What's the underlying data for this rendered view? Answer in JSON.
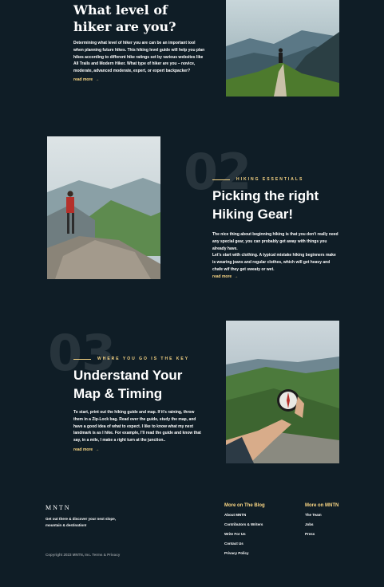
{
  "sections": [
    {
      "heading_lines": [
        "What level of",
        "hiker are you?"
      ],
      "body": "Determining what level of hiker you are can be an important tool when planning future hikes. This hiking level guide will help you plan hikes according to different hike ratings set by various websites like All Trails and Modern Hiker. What type of hiker are you – novice, moderate, advanced moderate, expert, or expert backpacker?",
      "read_more": "read more",
      "image_icon": "hiker-on-ridge-photo"
    },
    {
      "number": "02",
      "eyebrow": "HIKING ESSENTIALS",
      "heading_lines": [
        "Picking the right",
        "Hiking Gear!"
      ],
      "body": "The nice thing about beginning hiking is that you don't really need any special gear, you can probably get away with things you already have.\nLet's start with clothing. A typical mistake hiking beginners make is wearing jeans and regular clothes, which will get heavy and chafe wif they get sweaty or wet.",
      "read_more": "read more",
      "image_icon": "hiker-on-rock-photo"
    },
    {
      "number": "03",
      "eyebrow": "WHERE YOU GO IS THE KEY",
      "heading_lines": [
        "Understand Your",
        "Map & Timing"
      ],
      "body": "To start, print out the hiking guide and map. If it's raining, throw them in a Zip-Lock bag. Read over the guide, study the map, and have a good idea of what to expect. I like to know what my next landmark is as I hike. For example, I'll read the guide and know that say, in a mile, I make a right turn at the junction..",
      "read_more": "read more",
      "image_icon": "compass-in-hand-photo"
    }
  ],
  "footer": {
    "logo": "MNTN",
    "tagline": "Get out there & discover your next slope, mountain & destination!",
    "copyright": "Copyright 2023 MNTN, Inc. Terms & Privacy",
    "blog": {
      "title": "More on The Blog",
      "links": [
        "About MNTN",
        "Contributors & Writers",
        "Write For Us",
        "Contact Us",
        "Privacy Policy"
      ]
    },
    "mntn": {
      "title": "More on MNTN",
      "links": [
        "The Team",
        "Jobs",
        "Press"
      ]
    }
  },
  "colors": {
    "background": "#0f1d26",
    "accent": "#fbd784",
    "text": "#ffffff"
  }
}
